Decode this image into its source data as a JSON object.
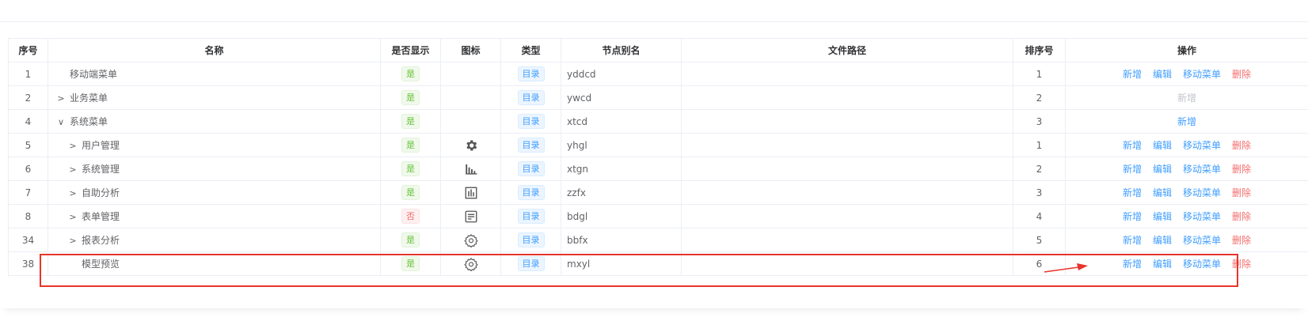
{
  "table": {
    "headers": {
      "index": "序号",
      "name": "名称",
      "visible": "是否显示",
      "icon": "图标",
      "type": "类型",
      "alias": "节点别名",
      "path": "文件路径",
      "order": "排序号",
      "actions": "操作"
    },
    "rows": [
      {
        "index": "1",
        "name": "移动端菜单",
        "level": 0,
        "expander": "",
        "visible": "是",
        "icon": "",
        "type": "目录",
        "alias": "yddcd",
        "path": "",
        "order": "1",
        "actions": [
          "新增",
          "编辑",
          "移动菜单",
          "删除"
        ],
        "actions_state": [
          "normal",
          "normal",
          "normal",
          "danger"
        ]
      },
      {
        "index": "2",
        "name": "业务菜单",
        "level": 0,
        "expander": "collapsed",
        "visible": "是",
        "icon": "",
        "type": "目录",
        "alias": "ywcd",
        "path": "",
        "order": "2",
        "actions": [
          "新增"
        ],
        "actions_state": [
          "disabled"
        ]
      },
      {
        "index": "4",
        "name": "系统菜单",
        "level": 0,
        "expander": "expanded",
        "visible": "是",
        "icon": "",
        "type": "目录",
        "alias": "xtcd",
        "path": "",
        "order": "3",
        "actions": [
          "新增"
        ],
        "actions_state": [
          "normal"
        ]
      },
      {
        "index": "5",
        "name": "用户管理",
        "level": 1,
        "expander": "collapsed",
        "visible": "是",
        "icon": "gear-filled-icon",
        "type": "目录",
        "alias": "yhgl",
        "path": "",
        "order": "1",
        "actions": [
          "新增",
          "编辑",
          "移动菜单",
          "删除"
        ],
        "actions_state": [
          "normal",
          "normal",
          "normal",
          "danger"
        ]
      },
      {
        "index": "6",
        "name": "系统管理",
        "level": 1,
        "expander": "collapsed",
        "visible": "是",
        "icon": "bar-chart-icon",
        "type": "目录",
        "alias": "xtgn",
        "path": "",
        "order": "2",
        "actions": [
          "新增",
          "编辑",
          "移动菜单",
          "删除"
        ],
        "actions_state": [
          "normal",
          "normal",
          "normal",
          "danger"
        ]
      },
      {
        "index": "7",
        "name": "自助分析",
        "level": 1,
        "expander": "collapsed",
        "visible": "是",
        "icon": "boxed-chart-icon",
        "type": "目录",
        "alias": "zzfx",
        "path": "",
        "order": "3",
        "actions": [
          "新增",
          "编辑",
          "移动菜单",
          "删除"
        ],
        "actions_state": [
          "normal",
          "normal",
          "normal",
          "danger"
        ]
      },
      {
        "index": "8",
        "name": "表单管理",
        "level": 1,
        "expander": "collapsed",
        "visible": "否",
        "icon": "form-icon",
        "type": "目录",
        "alias": "bdgl",
        "path": "",
        "order": "4",
        "actions": [
          "新增",
          "编辑",
          "移动菜单",
          "删除"
        ],
        "actions_state": [
          "normal",
          "normal",
          "normal",
          "danger"
        ]
      },
      {
        "index": "34",
        "name": "报表分析",
        "level": 1,
        "expander": "collapsed",
        "visible": "是",
        "icon": "gear-outline-icon",
        "type": "目录",
        "alias": "bbfx",
        "path": "",
        "order": "5",
        "actions": [
          "新增",
          "编辑",
          "移动菜单",
          "删除"
        ],
        "actions_state": [
          "normal",
          "normal",
          "normal",
          "danger"
        ]
      },
      {
        "index": "38",
        "name": "模型预览",
        "level": 1,
        "expander": "",
        "visible": "是",
        "icon": "gear-outline-icon",
        "type": "目录",
        "alias": "mxyl",
        "path": "",
        "order": "6",
        "actions": [
          "新增",
          "编辑",
          "移动菜单",
          "删除"
        ],
        "actions_state": [
          "normal",
          "normal",
          "normal",
          "danger"
        ]
      }
    ]
  },
  "colors": {
    "link": "#409eff",
    "danger": "#f56c6c",
    "success": "#67c23a",
    "annotation": "#e8342a"
  }
}
